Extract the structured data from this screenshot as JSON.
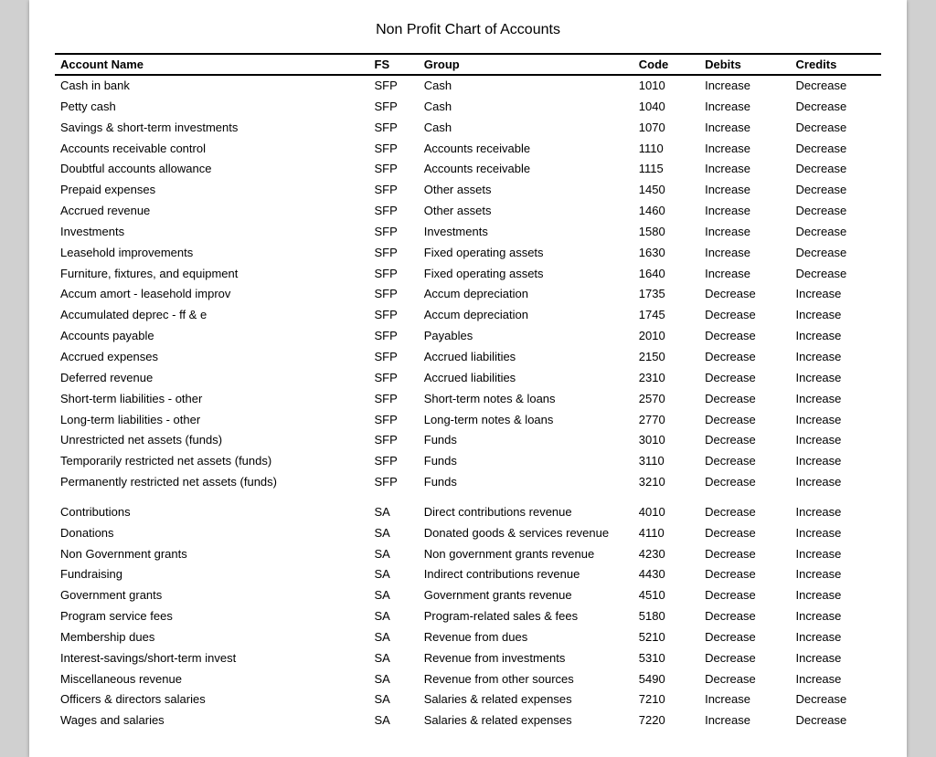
{
  "title": "Non Profit Chart of Accounts",
  "headers": {
    "name": "Account Name",
    "fs": "FS",
    "group": "Group",
    "code": "Code",
    "debits": "Debits",
    "credits": "Credits"
  },
  "rows": [
    {
      "name": "Cash in bank",
      "fs": "SFP",
      "group": "Cash",
      "code": "1010",
      "debits": "Increase",
      "credits": "Decrease"
    },
    {
      "name": "Petty cash",
      "fs": "SFP",
      "group": "Cash",
      "code": "1040",
      "debits": "Increase",
      "credits": "Decrease"
    },
    {
      "name": "Savings & short-term investments",
      "fs": "SFP",
      "group": "Cash",
      "code": "1070",
      "debits": "Increase",
      "credits": "Decrease"
    },
    {
      "name": "Accounts receivable control",
      "fs": "SFP",
      "group": "Accounts receivable",
      "code": "1110",
      "debits": "Increase",
      "credits": "Decrease"
    },
    {
      "name": "Doubtful accounts allowance",
      "fs": "SFP",
      "group": "Accounts receivable",
      "code": "1115",
      "debits": "Increase",
      "credits": "Decrease"
    },
    {
      "name": "Prepaid expenses",
      "fs": "SFP",
      "group": "Other assets",
      "code": "1450",
      "debits": "Increase",
      "credits": "Decrease"
    },
    {
      "name": "Accrued revenue",
      "fs": "SFP",
      "group": "Other assets",
      "code": "1460",
      "debits": "Increase",
      "credits": "Decrease"
    },
    {
      "name": "Investments",
      "fs": "SFP",
      "group": "Investments",
      "code": "1580",
      "debits": "Increase",
      "credits": "Decrease"
    },
    {
      "name": "Leasehold improvements",
      "fs": "SFP",
      "group": "Fixed operating assets",
      "code": "1630",
      "debits": "Increase",
      "credits": "Decrease"
    },
    {
      "name": "Furniture, fixtures, and equipment",
      "fs": "SFP",
      "group": "Fixed operating assets",
      "code": "1640",
      "debits": "Increase",
      "credits": "Decrease"
    },
    {
      "name": "Accum amort - leasehold improv",
      "fs": "SFP",
      "group": "Accum depreciation",
      "code": "1735",
      "debits": "Decrease",
      "credits": "Increase"
    },
    {
      "name": "Accumulated deprec - ff & e",
      "fs": "SFP",
      "group": "Accum depreciation",
      "code": "1745",
      "debits": "Decrease",
      "credits": "Increase"
    },
    {
      "name": "Accounts payable",
      "fs": "SFP",
      "group": "Payables",
      "code": "2010",
      "debits": "Decrease",
      "credits": "Increase"
    },
    {
      "name": "Accrued expenses",
      "fs": "SFP",
      "group": "Accrued liabilities",
      "code": "2150",
      "debits": "Decrease",
      "credits": "Increase"
    },
    {
      "name": "Deferred revenue",
      "fs": "SFP",
      "group": "Accrued liabilities",
      "code": "2310",
      "debits": "Decrease",
      "credits": "Increase"
    },
    {
      "name": "Short-term liabilities - other",
      "fs": "SFP",
      "group": "Short-term notes & loans",
      "code": "2570",
      "debits": "Decrease",
      "credits": "Increase"
    },
    {
      "name": "Long-term liabilities - other",
      "fs": "SFP",
      "group": "Long-term notes & loans",
      "code": "2770",
      "debits": "Decrease",
      "credits": "Increase"
    },
    {
      "name": "Unrestricted net assets (funds)",
      "fs": "SFP",
      "group": "Funds",
      "code": "3010",
      "debits": "Decrease",
      "credits": "Increase"
    },
    {
      "name": "Temporarily restricted  net assets (funds)",
      "fs": "SFP",
      "group": "Funds",
      "code": "3110",
      "debits": "Decrease",
      "credits": "Increase"
    },
    {
      "name": "Permanently restricted net assets (funds)",
      "fs": "SFP",
      "group": "Funds",
      "code": "3210",
      "debits": "Decrease",
      "credits": "Increase"
    },
    {
      "spacer": true
    },
    {
      "name": "Contributions",
      "fs": "SA",
      "group": "Direct contributions revenue",
      "code": "4010",
      "debits": "Decrease",
      "credits": "Increase"
    },
    {
      "name": "Donations",
      "fs": "SA",
      "group": "Donated goods & services revenue",
      "code": "4110",
      "debits": "Decrease",
      "credits": "Increase"
    },
    {
      "name": "Non Government grants",
      "fs": "SA",
      "group": "Non government grants revenue",
      "code": "4230",
      "debits": "Decrease",
      "credits": "Increase"
    },
    {
      "name": "Fundraising",
      "fs": "SA",
      "group": "Indirect contributions revenue",
      "code": "4430",
      "debits": "Decrease",
      "credits": "Increase"
    },
    {
      "name": "Government grants",
      "fs": "SA",
      "group": "Government grants revenue",
      "code": "4510",
      "debits": "Decrease",
      "credits": "Increase"
    },
    {
      "name": "Program service fees",
      "fs": "SA",
      "group": "Program-related sales & fees",
      "code": "5180",
      "debits": "Decrease",
      "credits": "Increase"
    },
    {
      "name": "Membership dues",
      "fs": "SA",
      "group": "Revenue from dues",
      "code": "5210",
      "debits": "Decrease",
      "credits": "Increase"
    },
    {
      "name": "Interest-savings/short-term invest",
      "fs": "SA",
      "group": "Revenue from investments",
      "code": "5310",
      "debits": "Decrease",
      "credits": "Increase"
    },
    {
      "name": "Miscellaneous revenue",
      "fs": "SA",
      "group": "Revenue from other sources",
      "code": "5490",
      "debits": "Decrease",
      "credits": "Increase"
    },
    {
      "name": "Officers & directors salaries",
      "fs": "SA",
      "group": "Salaries & related expenses",
      "code": "7210",
      "debits": "Increase",
      "credits": "Decrease"
    },
    {
      "name": "Wages and salaries",
      "fs": "SA",
      "group": "Salaries & related expenses",
      "code": "7220",
      "debits": "Increase",
      "credits": "Decrease"
    }
  ]
}
